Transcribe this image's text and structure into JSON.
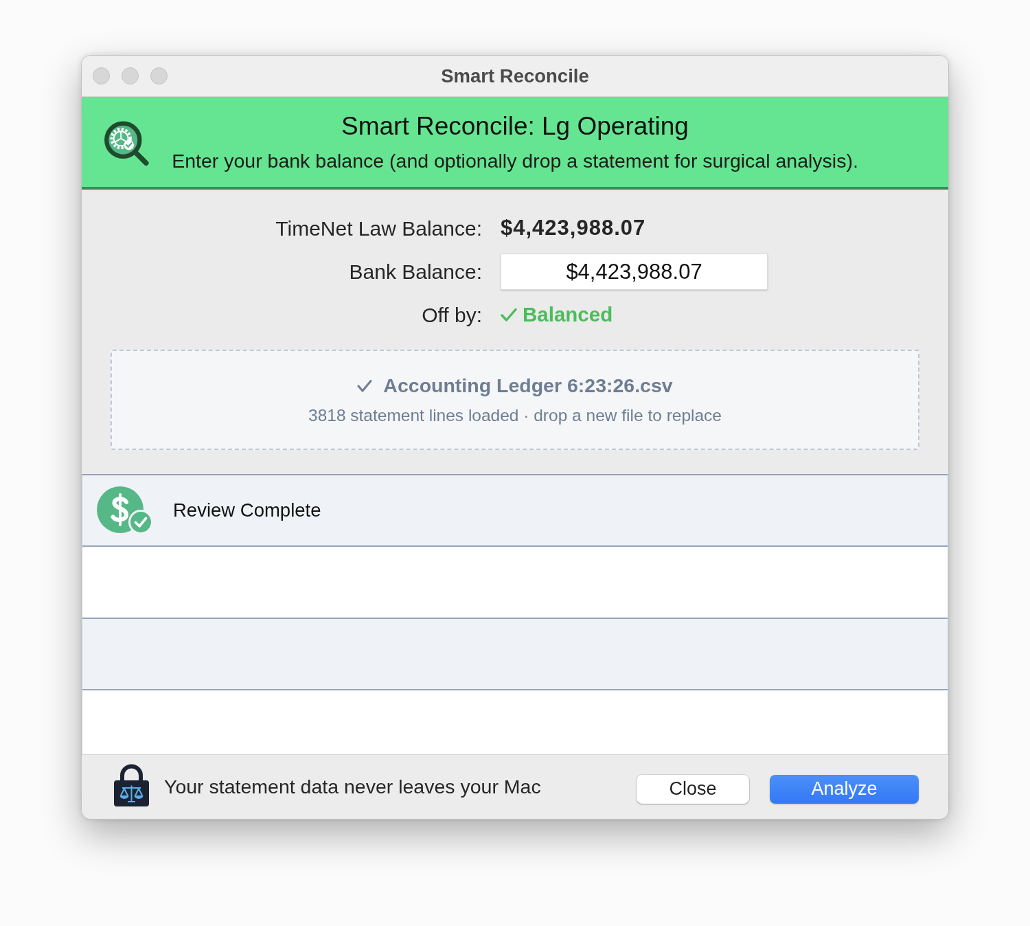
{
  "window": {
    "title": "Smart Reconcile"
  },
  "header": {
    "title": "Smart Reconcile: Lg Operating",
    "subtitle": "Enter your bank balance (and optionally drop a statement for surgical analysis)."
  },
  "fields": [
    {
      "kind": "static",
      "label": "TimeNet Law Balance:",
      "value": "$4,423,988.07"
    },
    {
      "kind": "input",
      "label": "Bank Balance:",
      "value": "$4,423,988.07"
    },
    {
      "kind": "status",
      "label": "Off by:",
      "value": "Balanced",
      "balanced": true
    }
  ],
  "drop_zone": {
    "loaded": true,
    "filename": "Accounting Ledger 6:23:26.csv",
    "detail": "3818 statement lines loaded · drop a new file to replace"
  },
  "list": {
    "items": [
      {
        "label": "Review Complete"
      }
    ]
  },
  "footer": {
    "note": "Your statement data never leaves your Mac",
    "buttons": [
      {
        "label": "Close",
        "default": false
      },
      {
        "label": "Analyze",
        "default": true
      }
    ]
  }
}
